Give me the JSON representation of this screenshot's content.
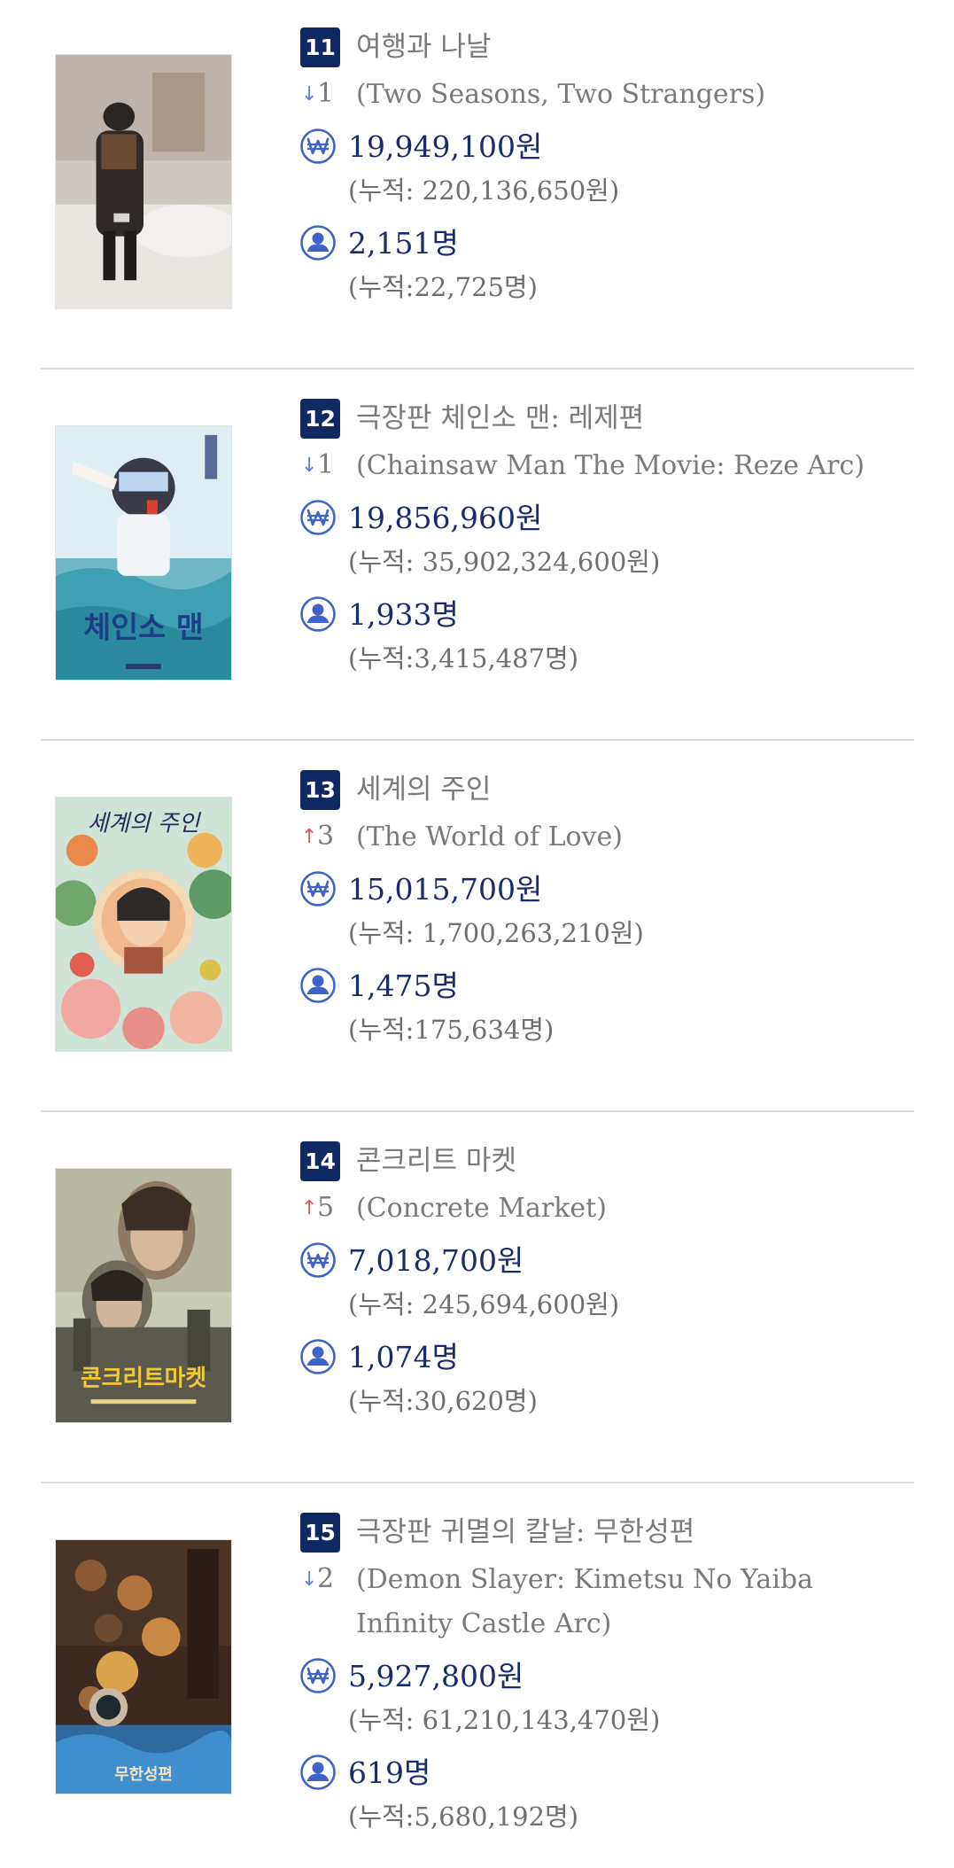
{
  "movies": [
    {
      "rank": "11",
      "title_ko": "여행과 나날",
      "change_direction": "down",
      "change_value": "1",
      "title_en": "(Two Seasons, Two Strangers)",
      "revenue": "19,949,100원",
      "revenue_cumulative": "(누적: 220,136,650원)",
      "audience": "2,151명",
      "audience_cumulative": "(누적:22,725명)"
    },
    {
      "rank": "12",
      "title_ko": "극장판 체인소 맨: 레제편",
      "change_direction": "down",
      "change_value": "1",
      "title_en": "(Chainsaw Man The Movie: Reze Arc)",
      "revenue": "19,856,960원",
      "revenue_cumulative": "(누적: 35,902,324,600원)",
      "audience": "1,933명",
      "audience_cumulative": "(누적:3,415,487명)",
      "poster_text": "체인소 맨"
    },
    {
      "rank": "13",
      "title_ko": "세계의 주인",
      "change_direction": "up",
      "change_value": "3",
      "title_en": "(The World of Love)",
      "revenue": "15,015,700원",
      "revenue_cumulative": "(누적: 1,700,263,210원)",
      "audience": "1,475명",
      "audience_cumulative": "(누적:175,634명)",
      "poster_text": "세계의 주인"
    },
    {
      "rank": "14",
      "title_ko": "콘크리트 마켓",
      "change_direction": "up",
      "change_value": "5",
      "title_en": "(Concrete Market)",
      "revenue": "7,018,700원",
      "revenue_cumulative": "(누적: 245,694,600원)",
      "audience": "1,074명",
      "audience_cumulative": "(누적:30,620명)",
      "poster_text": "콘크리트마켓"
    },
    {
      "rank": "15",
      "title_ko": "극장판 귀멸의 칼날: 무한성편",
      "change_direction": "down",
      "change_value": "2",
      "title_en": "(Demon Slayer: Kimetsu No Yaiba Infinity Castle Arc)",
      "revenue": "5,927,800원",
      "revenue_cumulative": "(누적: 61,210,143,470원)",
      "audience": "619명",
      "audience_cumulative": "(누적:5,680,192명)",
      "poster_text": "무한성편"
    }
  ],
  "arrows": {
    "down": "↓",
    "up": "↑"
  },
  "icons": {
    "revenue": "won-coin-icon",
    "audience": "person-icon"
  },
  "colors": {
    "rank_badge": "#0f2a63",
    "value_text": "#1a2b6d",
    "muted_text": "#7a7a7a",
    "icon_blue": "#3f63c9",
    "arrow_down": "#5a7fd8",
    "arrow_up": "#e05a4a"
  }
}
